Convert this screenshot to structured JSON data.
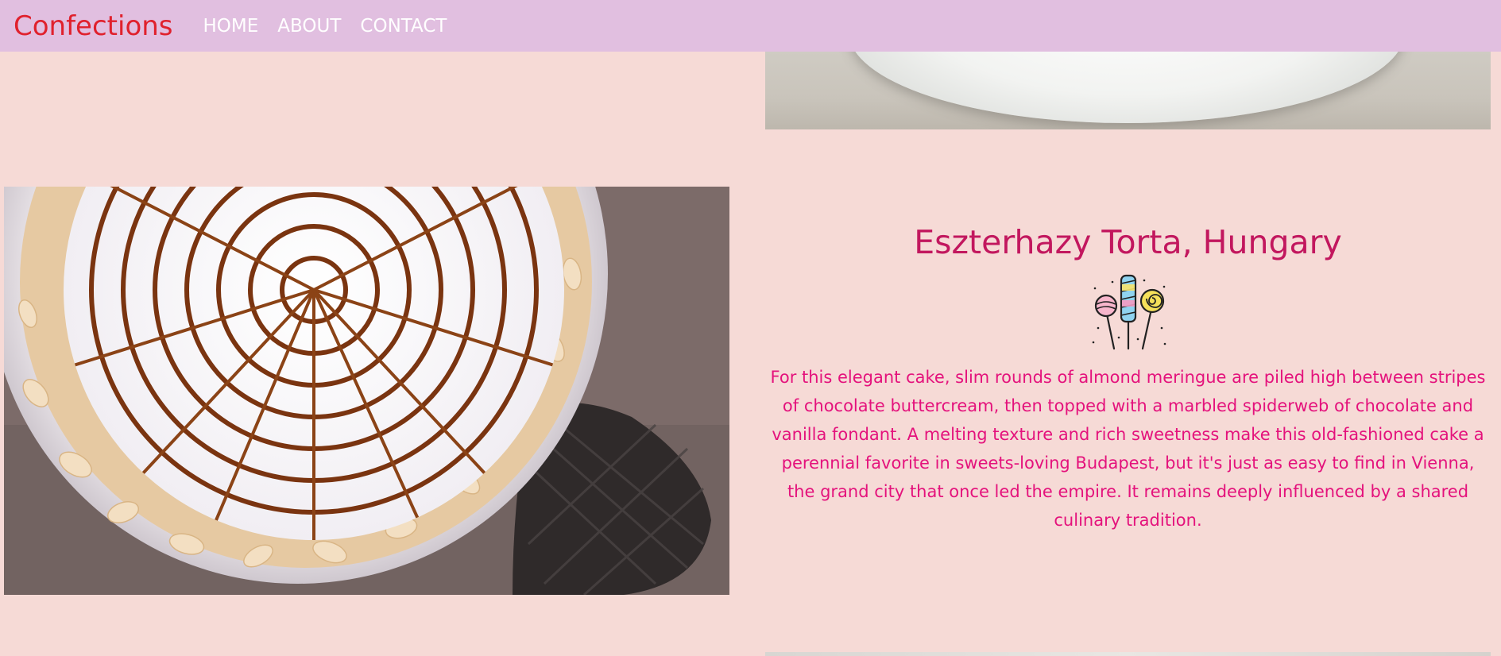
{
  "nav": {
    "brand": "Confections",
    "links": [
      "HOME",
      "ABOUT",
      "CONTACT"
    ]
  },
  "article": {
    "title": "Eszterhazy Torta, Hungary",
    "icon": "lollipop-candy-icon",
    "description": "For this elegant cake, slim rounds of almond meringue are piled high between stripes of chocolate buttercream, then topped with a marbled spiderweb of chocolate and vanilla fondant. A melting texture and rich sweetness make this old-fashioned cake a perennial favorite in sweets-loving Budapest, but it's just as easy to find in Vienna, the grand city that once led the empire. It remains deeply influenced by a shared culinary tradition."
  },
  "colors": {
    "page_background": "#f6dad6",
    "navbar_background": "#e1bfe0",
    "brand": "#e0212d",
    "title": "#c2175e",
    "description": "#e4127c"
  }
}
